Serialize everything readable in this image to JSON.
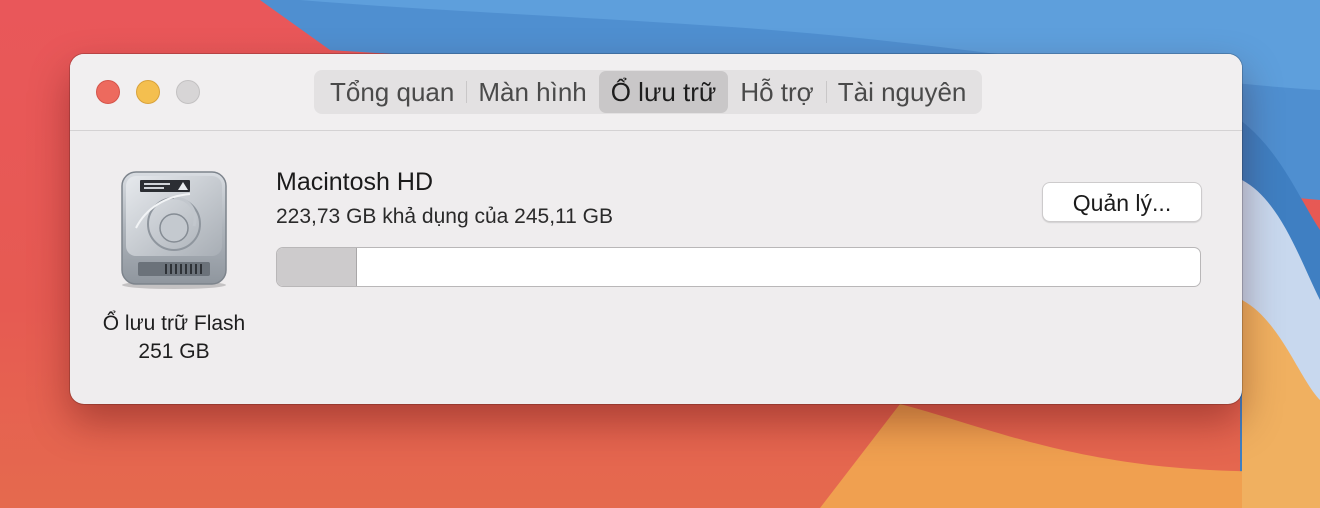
{
  "window": {
    "tabs": [
      {
        "label": "Tổng quan",
        "active": false
      },
      {
        "label": "Màn hình",
        "active": false
      },
      {
        "label": "Ổ lưu trữ",
        "active": true
      },
      {
        "label": "Hỗ trợ",
        "active": false
      },
      {
        "label": "Tài nguyên",
        "active": false
      }
    ]
  },
  "storage": {
    "disk_label": "Ổ lưu trữ Flash",
    "disk_size": "251 GB",
    "disk_icon": "hard-drive-icon",
    "volume_name": "Macintosh HD",
    "volume_info": "223,73 GB khả dụng của 245,11 GB",
    "manage_label": "Quản lý...",
    "used_fraction": 0.087
  },
  "colors": {
    "close": "#ed6a5e",
    "minimize": "#f4bf4f",
    "zoom_disabled": "#d7d5d6",
    "used_segment": "#cdcbcc"
  }
}
